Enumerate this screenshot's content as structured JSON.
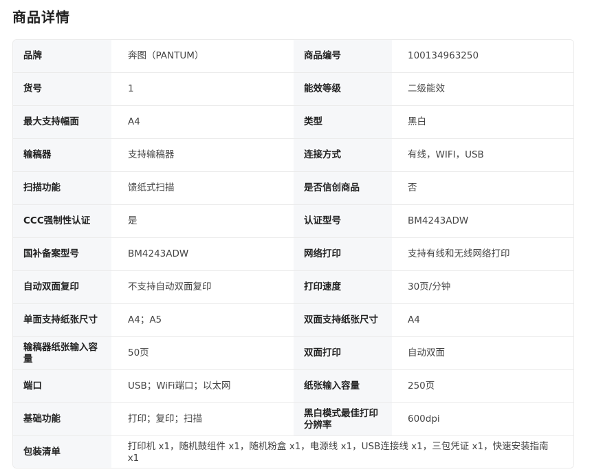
{
  "page_title": "商品详情",
  "rows": [
    {
      "k1": "品牌",
      "v1": "奔图（PANTUM）",
      "k2": "商品编号",
      "v2": "100134963250"
    },
    {
      "k1": "货号",
      "v1": "1",
      "k2": "能效等级",
      "v2": "二级能效"
    },
    {
      "k1": "最大支持幅面",
      "v1": "A4",
      "k2": "类型",
      "v2": "黑白"
    },
    {
      "k1": "输稿器",
      "v1": "支持输稿器",
      "k2": "连接方式",
      "v2": "有线，WIFI，USB"
    },
    {
      "k1": "扫描功能",
      "v1": "馈纸式扫描",
      "k2": "是否信创商品",
      "v2": "否"
    },
    {
      "k1": "CCC强制性认证",
      "v1": "是",
      "k2": "认证型号",
      "v2": "BM4243ADW"
    },
    {
      "k1": "国补备案型号",
      "v1": "BM4243ADW",
      "k2": "网络打印",
      "v2": "支持有线和无线网络打印"
    },
    {
      "k1": "自动双面复印",
      "v1": "不支持自动双面复印",
      "k2": "打印速度",
      "v2": "30页/分钟"
    },
    {
      "k1": "单面支持纸张尺寸",
      "v1": "A4；A5",
      "k2": "双面支持纸张尺寸",
      "v2": "A4"
    },
    {
      "k1": "输稿器纸张输入容量",
      "v1": "50页",
      "k2": "双面打印",
      "v2": "自动双面"
    },
    {
      "k1": "端口",
      "v1": "USB；WiFi端口；以太网",
      "k2": "纸张输入容量",
      "v2": "250页"
    },
    {
      "k1": "基础功能",
      "v1": "打印；复印；扫描",
      "k2": "黑白模式最佳打印分辨率",
      "v2": "600dpi"
    }
  ],
  "packing": {
    "label": "包装清单",
    "value": "打印机 x1，随机鼓组件 x1，随机粉盒 x1，电源线 x1，USB连接线 x1，三包凭证 x1，快速安装指南 x1"
  }
}
